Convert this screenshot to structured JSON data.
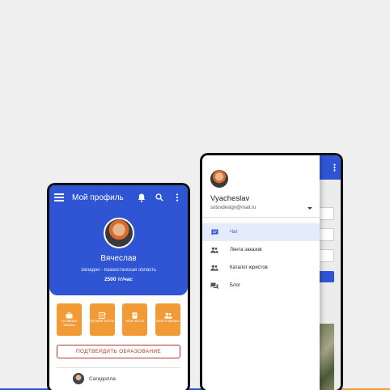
{
  "colors": {
    "primary": "#2f55d4",
    "accent": "#f29a35",
    "danger": "#b8352b",
    "active_bg": "#e4ebfa"
  },
  "profile_screen": {
    "header": {
      "title": "Мой профиль",
      "icons": [
        "menu-icon",
        "bell-icon",
        "search-icon",
        "more-vert-icon"
      ]
    },
    "profile": {
      "name": "Вячеслав",
      "region": "Западно - Казахстанская область",
      "rate": "2500 тг/час"
    },
    "tiles": [
      {
        "icon": "briefcase-icon",
        "label": "Активные заказы"
      },
      {
        "icon": "edit-note-icon",
        "label": "Лучшие посты"
      },
      {
        "icon": "document-icon",
        "label": "Мои посты"
      },
      {
        "icon": "group-icon",
        "label": "Мои стажеры"
      }
    ],
    "confirm_education_label": "ПОДТВЕРДИТЬ ОБРАЗОВАНИЕ",
    "people": [
      {
        "name": "Сагидолла"
      }
    ]
  },
  "drawer_screen": {
    "user": {
      "name": "Vyacheslav",
      "email": "sotovdesign@mail.ru"
    },
    "menu": [
      {
        "icon": "chat-icon",
        "label": "Чат",
        "active": true
      },
      {
        "icon": "group-icon",
        "label": "Лента заказов",
        "active": false
      },
      {
        "icon": "group-icon",
        "label": "Каталог юристов",
        "active": false
      },
      {
        "icon": "forum-icon",
        "label": "Блог",
        "active": false
      }
    ]
  }
}
